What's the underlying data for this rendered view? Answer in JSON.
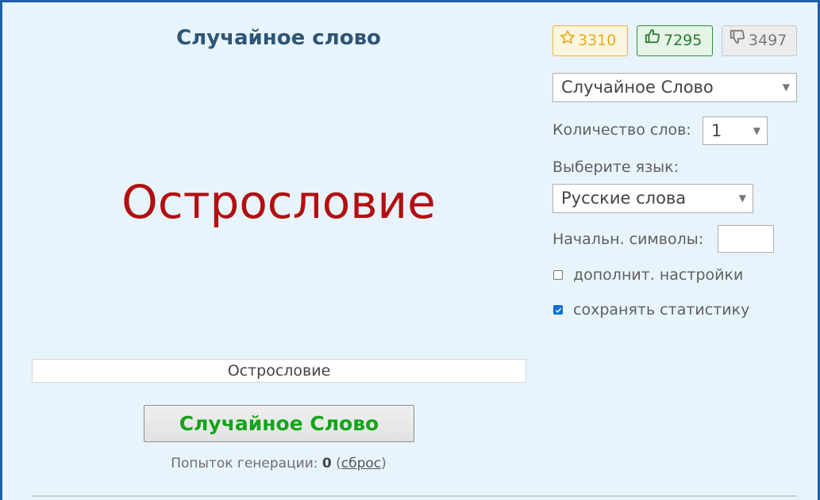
{
  "main": {
    "title": "Случайное слово",
    "big_word": "Острословие",
    "word_field_value": "Острословие",
    "generate_button": "Случайное Слово",
    "attempts_label": "Попыток генерации:",
    "attempts_count": "0",
    "reset_link": "сброс"
  },
  "rating": {
    "favorites": "3310",
    "likes": "7295",
    "dislikes": "3497"
  },
  "settings": {
    "generator_select": "Случайное Слово",
    "word_count_label": "Количество слов:",
    "word_count_value": "1",
    "language_label": "Выберите язык:",
    "language_select": "Русские слова",
    "start_chars_label": "Начальн. символы:",
    "start_chars_value": "",
    "extra_settings_label": "дополнит. настройки",
    "extra_settings_checked": false,
    "save_stats_label": "сохранять статистику",
    "save_stats_checked": true
  },
  "colors": {
    "frame_border": "#1f5fa8",
    "background": "#e8f4fc",
    "word": "#b30e10",
    "button_text": "#14a31b",
    "title": "#2d5577"
  }
}
